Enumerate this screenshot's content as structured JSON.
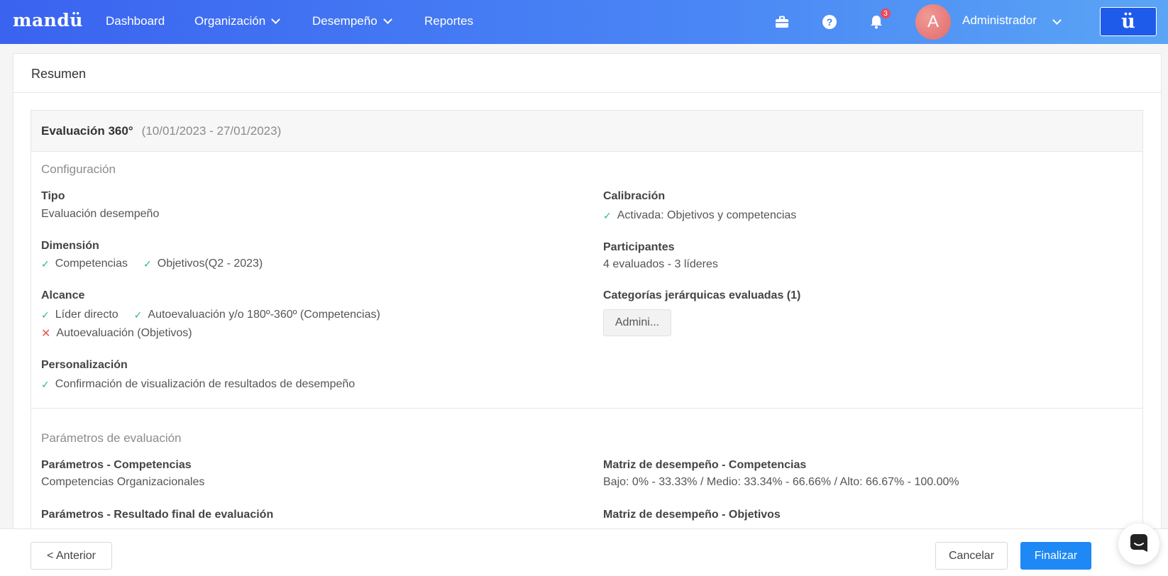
{
  "nav": {
    "logo": "mandü",
    "items": [
      "Dashboard",
      "Organización",
      "Desempeño",
      "Reportes"
    ],
    "notifications_count": "3",
    "avatar_initial": "A",
    "user_name": "Administrador",
    "brand_button": "ü"
  },
  "page": {
    "title": "Resumen"
  },
  "evaluation": {
    "name": "Evaluación 360°",
    "dates": "(10/01/2023 - 27/01/2023)"
  },
  "config": {
    "section_title": "Configuración",
    "tipo_label": "Tipo",
    "tipo_value": "Evaluación desempeño",
    "dimension_label": "Dimensión",
    "dimension_items": [
      "Competencias",
      "Objetivos(Q2 - 2023)"
    ],
    "alcance_label": "Alcance",
    "alcance_items": [
      "Líder directo",
      "Autoevaluación y/o 180º-360º (Competencias)"
    ],
    "alcance_excluded": "Autoevaluación (Objetivos)",
    "personalizacion_label": "Personalización",
    "personalizacion_item": "Confirmación de visualización de resultados de desempeño",
    "calibracion_label": "Calibración",
    "calibracion_value": "Activada: Objetivos y competencias",
    "participantes_label": "Participantes",
    "participantes_value": "4 evaluados - 3 líderes",
    "categorias_label": "Categorías jerárquicas evaluadas (1)",
    "categorias_chip": "Admini..."
  },
  "params": {
    "section_title": "Parámetros de evaluación",
    "competencias_label": "Parámetros - Competencias",
    "competencias_value": "Competencias Organizacionales",
    "resultado_label": "Parámetros - Resultado final de evaluación",
    "matriz_comp_label": "Matriz de desempeño - Competencias",
    "matriz_comp_value": "Bajo: 0% - 33.33% / Medio: 33.34% - 66.66% / Alto: 66.67% - 100.00%",
    "matriz_obj_label": "Matriz de desempeño - Objetivos"
  },
  "footer": {
    "prev_button": "< Anterior",
    "cancel_button": "Cancelar",
    "finish_button": "Finalizar"
  },
  "colors": {
    "nav_start": "#3a63f0",
    "nav_end": "#5aa5f5",
    "primary": "#1e88f5",
    "check": "#2bb592",
    "cross": "#e2574c"
  }
}
